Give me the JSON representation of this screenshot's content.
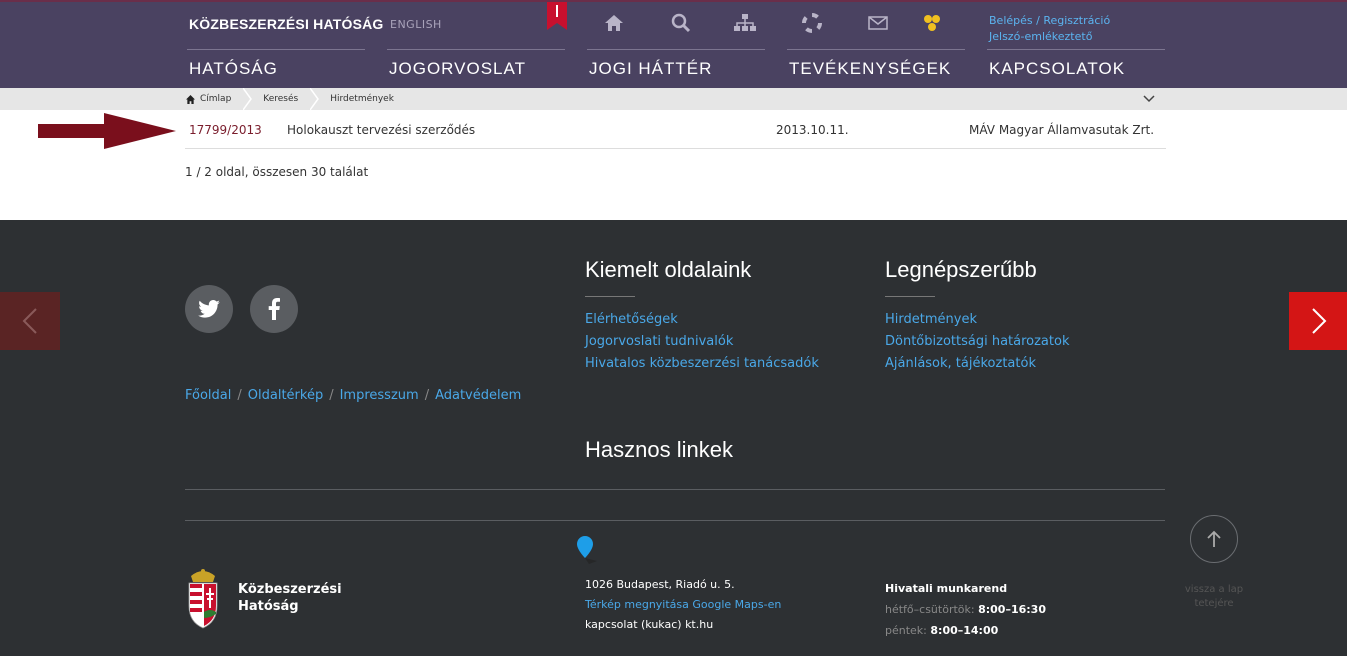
{
  "header": {
    "logo": "KÖZBESZERZÉSI HATÓSÁG",
    "lang": "ENGLISH",
    "auth": {
      "login": "Belépés",
      "sep": "/",
      "register": "Regisztráció",
      "reminder": "Jelszó-emlékeztető"
    },
    "nav": [
      "HATÓSÁG",
      "JOGORVOSLAT",
      "JOGI HÁTTÉR",
      "TEVÉKENYSÉGEK",
      "KAPCSOLATOK"
    ],
    "icons": [
      "home-icon",
      "search-icon",
      "sitemap-icon",
      "help-icon",
      "mail-icon",
      "logo-icon"
    ]
  },
  "breadcrumb": [
    "Címlap",
    "Keresés",
    "Hirdetmények"
  ],
  "result": {
    "id": "17799/2013",
    "title": "Holokauszt tervezési szerződés",
    "date": "2013.10.11.",
    "org": "MÁV Magyar Államvasutak Zrt."
  },
  "pager": "1 / 2 oldal, összesen 30 találat",
  "footer": {
    "links": [
      "Főoldal",
      "Oldaltérkép",
      "Impresszum",
      "Adatvédelem"
    ],
    "featured": {
      "title": "Kiemelt oldalaink",
      "items": [
        "Elérhetőségek",
        "Jogorvoslati tudnivalók",
        "Hivatalos közbeszerzési tanácsadók"
      ]
    },
    "popular": {
      "title": "Legnépszerűbb",
      "items": [
        "Hirdetmények",
        "Döntőbizottsági határozatok",
        "Ajánlások, tájékoztatók"
      ]
    },
    "useful": "Hasznos linkek",
    "org": {
      "line1": "Közbeszerzési",
      "line2": "Hatóság"
    },
    "address": "1026 Budapest, Riadó u. 5.",
    "maplink": "Térkép megnyitása Google Maps-en",
    "email": "kapcsolat (kukac) kt.hu",
    "hours": {
      "title": "Hivatali munkarend",
      "d1": "hétfő–csütörtök:",
      "t1": "8:00–16:30",
      "d2": "péntek:",
      "t2": "8:00–14:00"
    },
    "totop": {
      "line1": "vissza a lap",
      "line2": "tetejére"
    }
  },
  "colors": {
    "header": "#4a4261",
    "footer": "#2d3033",
    "link": "#4aa8e8",
    "accent": "#d41515"
  }
}
